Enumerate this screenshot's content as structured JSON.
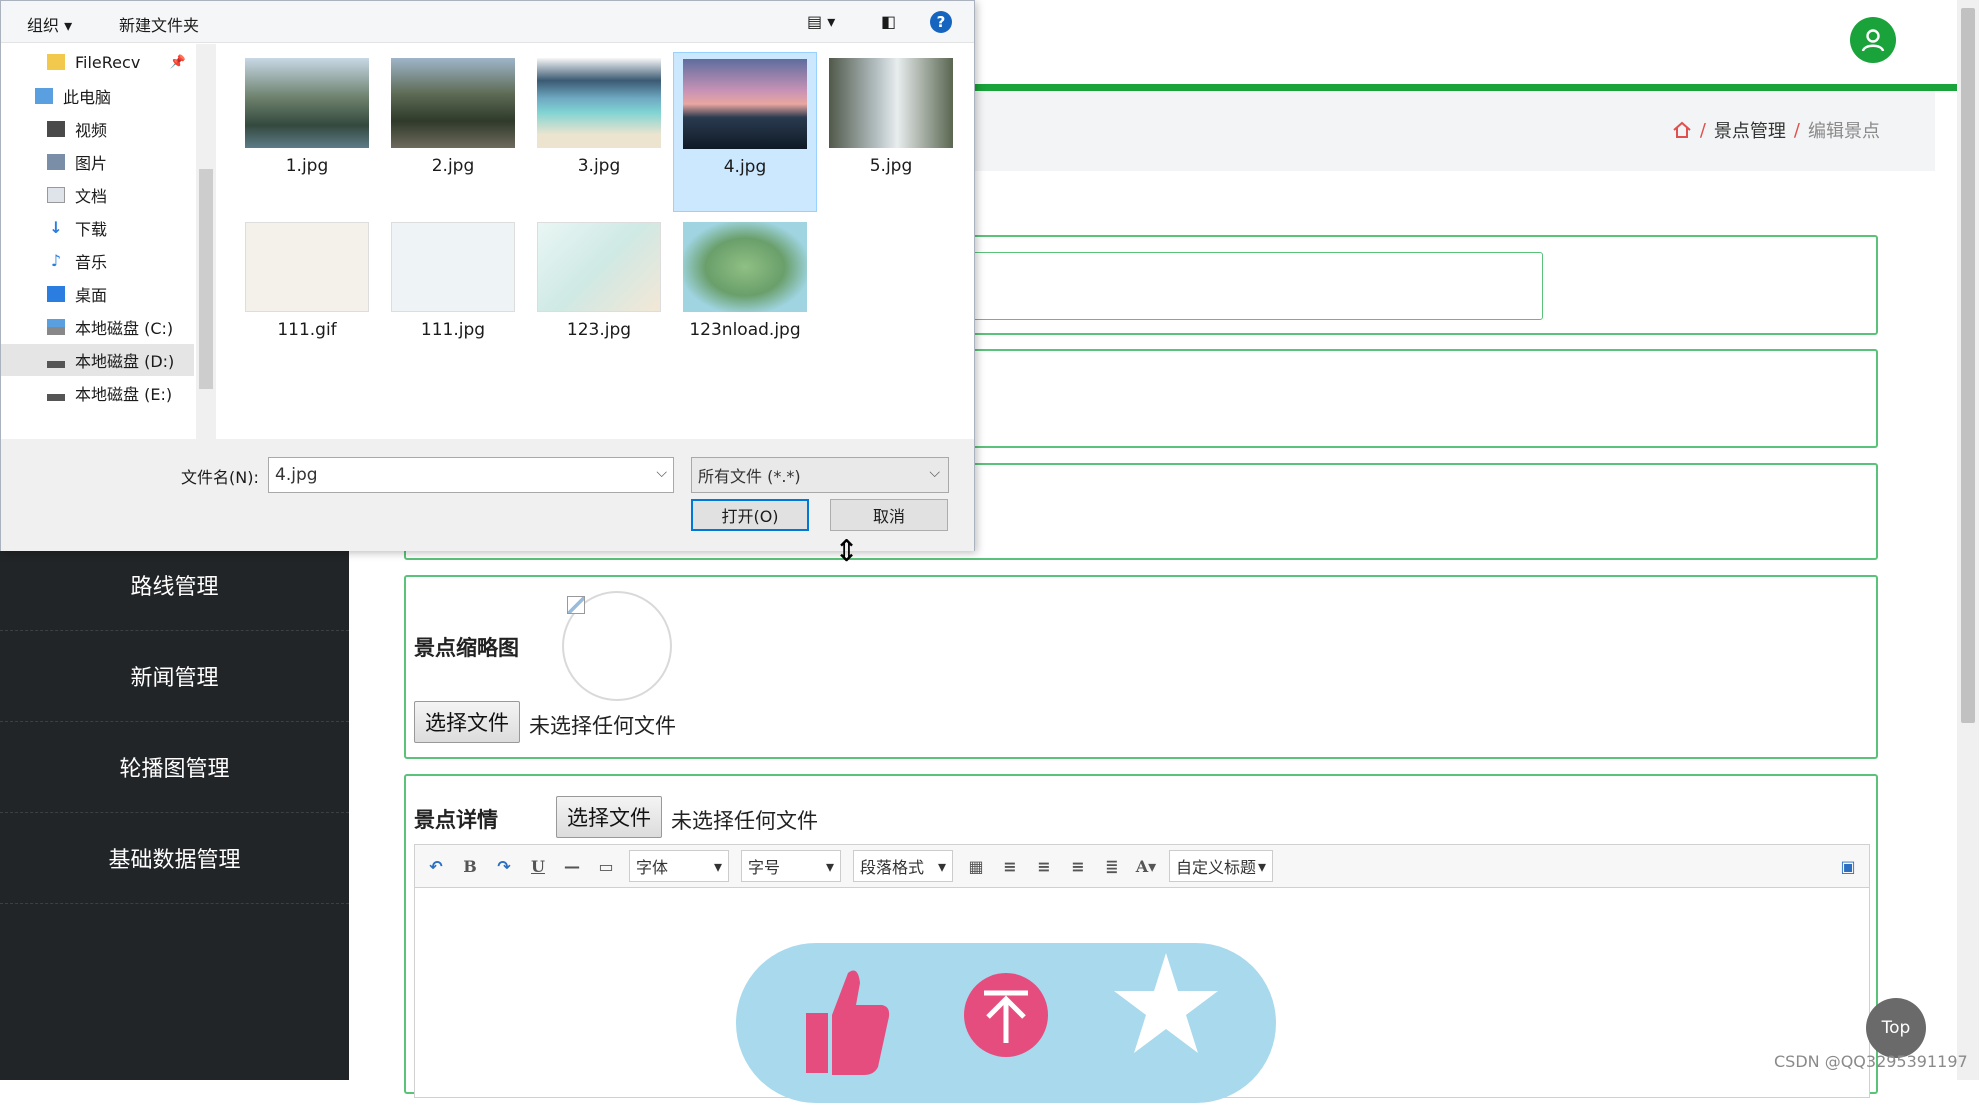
{
  "dialog": {
    "toolbar": {
      "organize": "组织 ▾",
      "new_folder": "新建文件夹",
      "help": "?"
    },
    "nav": [
      "FileRecv",
      "此电脑",
      "视频",
      "图片",
      "文档",
      "下载",
      "音乐",
      "桌面",
      "本地磁盘 (C:)",
      "本地磁盘 (D:)",
      "本地磁盘 (E:)"
    ],
    "files": [
      "1.jpg",
      "2.jpg",
      "3.jpg",
      "4.jpg",
      "5.jpg",
      "111.gif",
      "111.jpg",
      "123.jpg",
      "123nload.jpg"
    ],
    "filename_label": "文件名(N):",
    "filename_value": "4.jpg",
    "filetype": "所有文件 (*.*)",
    "open_button": "打开(O)",
    "cancel_button": "取消"
  },
  "breadcrumb": {
    "sep": "/",
    "parent": "景点管理",
    "current": "编辑景点"
  },
  "sidebar": {
    "items": [
      "路线管理",
      "新闻管理",
      "轮播图管理",
      "基础数据管理"
    ]
  },
  "form": {
    "thumb_label": "景点缩略图",
    "detail_label": "景点详情",
    "choose_file": "选择文件",
    "no_file": "未选择任何文件",
    "editor": {
      "font": "字体",
      "size": "字号",
      "paragraph": "段落格式",
      "custom_title": "自定义标题"
    }
  },
  "top_button": "Top",
  "watermark": "CSDN @QQ3295391197",
  "colors": {
    "accent": "#1aa33a",
    "panel_border": "#5bc27a",
    "sidebar_bg": "#222527",
    "selection": "#cce8ff"
  }
}
